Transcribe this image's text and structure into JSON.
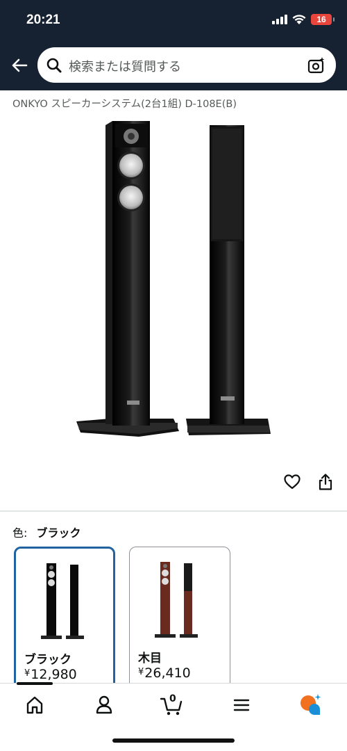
{
  "status_bar": {
    "time": "20:21",
    "battery": "16"
  },
  "search": {
    "placeholder": "検索または質問する"
  },
  "product": {
    "title": "ONKYO スピーカーシステム(2台1組) D-108E(B)"
  },
  "variation": {
    "label": "色:",
    "selected": "ブラック",
    "options": [
      {
        "name": "ブラック",
        "currency": "¥",
        "price": "12,980",
        "color": "#111111"
      },
      {
        "name": "木目",
        "currency": "¥",
        "price": "26,410",
        "color": "#6b2a1f"
      }
    ]
  },
  "nav": {
    "cart_count": "0"
  },
  "colors": {
    "header_bg": "#162131",
    "selected_border": "#2162a1"
  }
}
